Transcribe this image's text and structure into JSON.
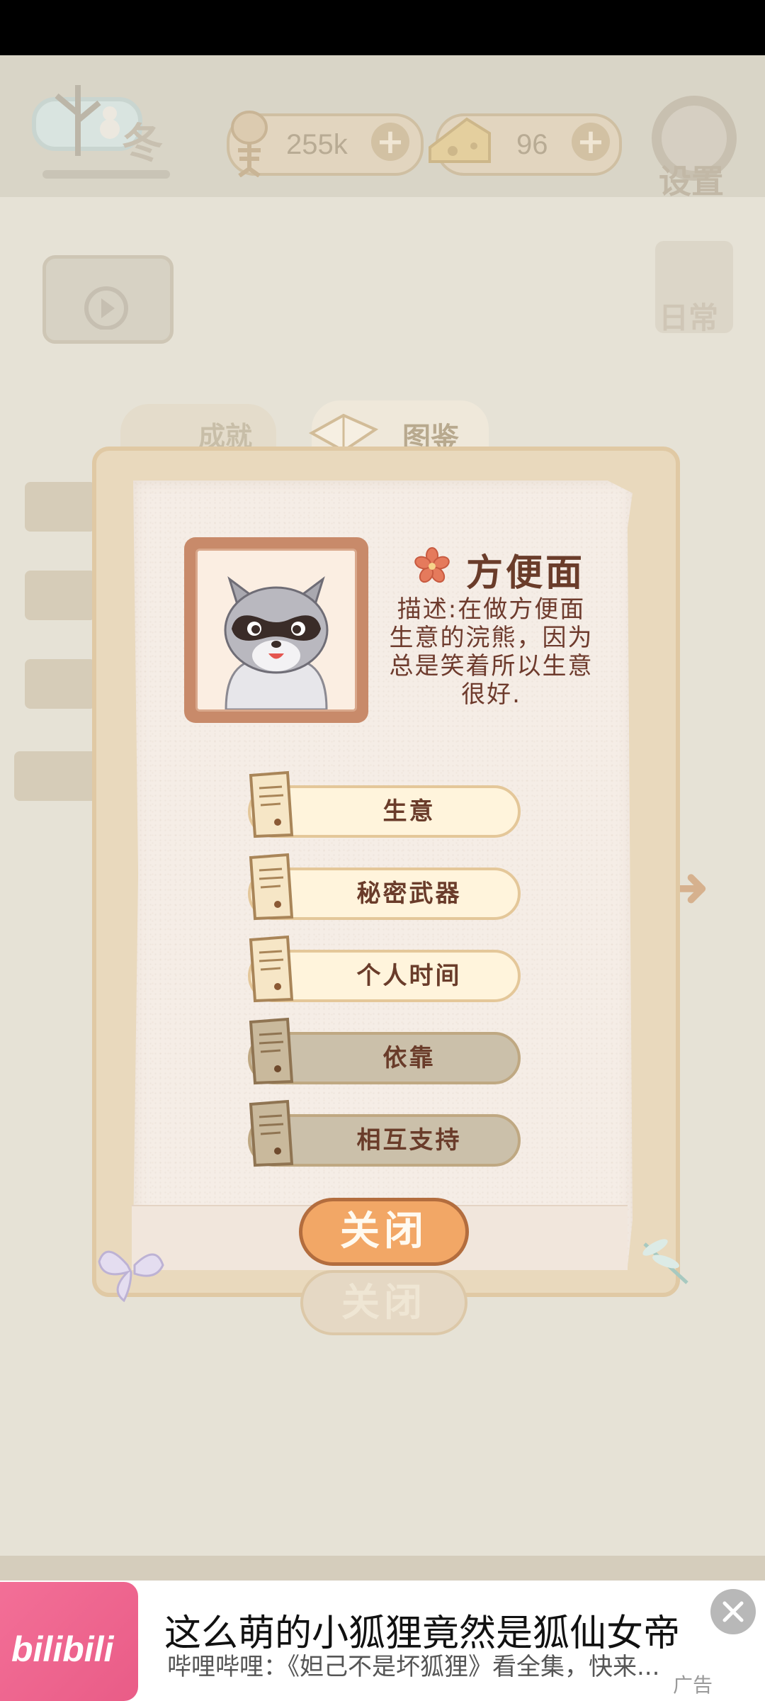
{
  "hud": {
    "season_label": "冬",
    "fish_amount": "255k",
    "cheese_amount": "96",
    "settings_label": "设置",
    "daily_label": "日常"
  },
  "tabs": {
    "achievement": "成就",
    "collection": "图鉴"
  },
  "card": {
    "name": "方便面",
    "description": "描述:在做方便面生意的浣熊，因为总是笑着所以生意很好.",
    "stories": [
      {
        "label": "生意",
        "unlocked": true
      },
      {
        "label": "秘密武器",
        "unlocked": true
      },
      {
        "label": "个人时间",
        "unlocked": true
      },
      {
        "label": "依靠",
        "unlocked": false
      },
      {
        "label": "相互支持",
        "unlocked": false
      }
    ],
    "close_label": "关闭"
  },
  "ad": {
    "brand": "bilibili",
    "title": "这么萌的小狐狸竟然是狐仙女帝",
    "subtitle": "哔哩哔哩：《妲己不是坏狐狸》看全集，快来...",
    "tag": "广告"
  },
  "colors": {
    "close_button": "#f2a766",
    "locked_button": "#cbc0aa",
    "unlocked_button": "#fff4dc",
    "ad_brand": "#f36f97"
  }
}
